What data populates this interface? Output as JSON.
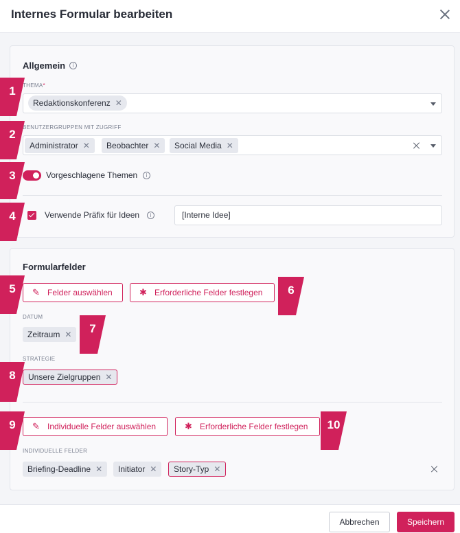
{
  "dialog": {
    "title": "Internes Formular bearbeiten"
  },
  "general": {
    "title": "Allgemein",
    "topic": {
      "label": "THEMA",
      "required_mark": "*",
      "chips": [
        "Redaktionskonferenz"
      ]
    },
    "user_groups": {
      "label": "BENUTZERGRUPPEN MIT ZUGRIFF",
      "chips": [
        "Administrator",
        "Beobachter",
        "Social Media"
      ]
    },
    "suggested_topics": {
      "label": "Vorgeschlagene Themen",
      "enabled": true
    },
    "prefix": {
      "label": "Verwende Präfix für Ideen",
      "checked": true,
      "value": "[Interne Idee]"
    }
  },
  "form_fields": {
    "title": "Formularfelder",
    "select_fields_label": "Felder auswählen",
    "required_fields_label": "Erforderliche Felder festlegen",
    "date": {
      "label": "DATUM",
      "chips": [
        "Zeitraum"
      ]
    },
    "strategy": {
      "label": "STRATEGIE",
      "chips": [
        "Unsere Zielgruppen"
      ]
    },
    "select_custom_fields_label": "Individuelle Felder auswählen",
    "custom_required_fields_label": "Erforderliche Felder festlegen",
    "custom": {
      "label": "INDIVIDUELLE FELDER",
      "chips": [
        "Briefing-Deadline",
        "Initiator",
        "Story-Typ"
      ]
    }
  },
  "footer": {
    "cancel_label": "Abbrechen",
    "save_label": "Speichern"
  },
  "markers": [
    "1",
    "2",
    "3",
    "4",
    "5",
    "6",
    "7",
    "8",
    "9",
    "10"
  ],
  "icons": {
    "edit": "edit-icon",
    "asterisk": "asterisk-icon",
    "info": "info-icon",
    "close": "close-icon",
    "caret": "chevron-down-icon"
  },
  "colors": {
    "accent": "#d0215b",
    "chip_bg": "#e6e8ee",
    "background": "#f4f5f8"
  }
}
